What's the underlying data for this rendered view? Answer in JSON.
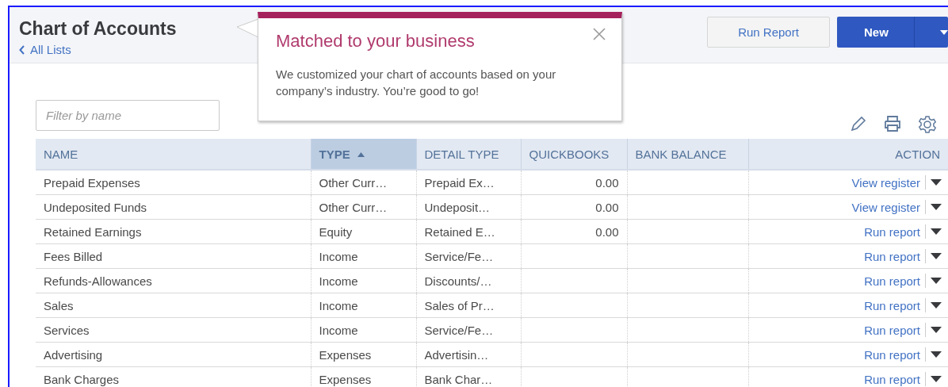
{
  "header": {
    "title": "Chart of Accounts",
    "back_link": "All Lists",
    "buttons": [
      {
        "label": "Run Report",
        "kind": "secondary"
      },
      {
        "label": "New",
        "kind": "primary"
      }
    ]
  },
  "popover": {
    "title": "Matched to your business",
    "message": "We customized your chart of accounts based on your company’s industry. You’re good to go!"
  },
  "filter": {
    "placeholder": "Filter by name"
  },
  "table": {
    "columns": [
      {
        "label": "NAME",
        "selected": false
      },
      {
        "label": "TYPE",
        "selected": true
      },
      {
        "label": "DETAIL TYPE",
        "selected": false
      },
      {
        "label": "QUICKBOOKS",
        "selected": false
      },
      {
        "label": "BANK BALANCE",
        "selected": false
      },
      {
        "label": "ACTION",
        "selected": false
      }
    ],
    "rows": [
      {
        "name": "Prepaid Expenses",
        "type": "Other Curr…",
        "detail_type": "Prepaid Ex…",
        "quickbooks": "0.00",
        "action": "View register"
      },
      {
        "name": "Undeposited Funds",
        "type": "Other Curr…",
        "detail_type": "Undeposit…",
        "quickbooks": "0.00",
        "action": "View register"
      },
      {
        "name": "Retained Earnings",
        "type": "Equity",
        "detail_type": "Retained E…",
        "quickbooks": "0.00",
        "action": "Run report"
      },
      {
        "name": "Fees Billed",
        "type": "Income",
        "detail_type": "Service/Fe…",
        "action": "Run report"
      },
      {
        "name": "Refunds-Allowances",
        "type": "Income",
        "detail_type": "Discounts/…",
        "action": "Run report"
      },
      {
        "name": "Sales",
        "type": "Income",
        "detail_type": "Sales of Pr…",
        "action": "Run report"
      },
      {
        "name": "Services",
        "type": "Income",
        "detail_type": "Service/Fe…",
        "action": "Run report"
      },
      {
        "name": "Advertising",
        "type": "Expenses",
        "detail_type": "Advertisin…",
        "action": "Run report"
      },
      {
        "name": "Bank Charges",
        "type": "Expenses",
        "detail_type": "Bank Char…",
        "action": "Run report"
      }
    ]
  }
}
